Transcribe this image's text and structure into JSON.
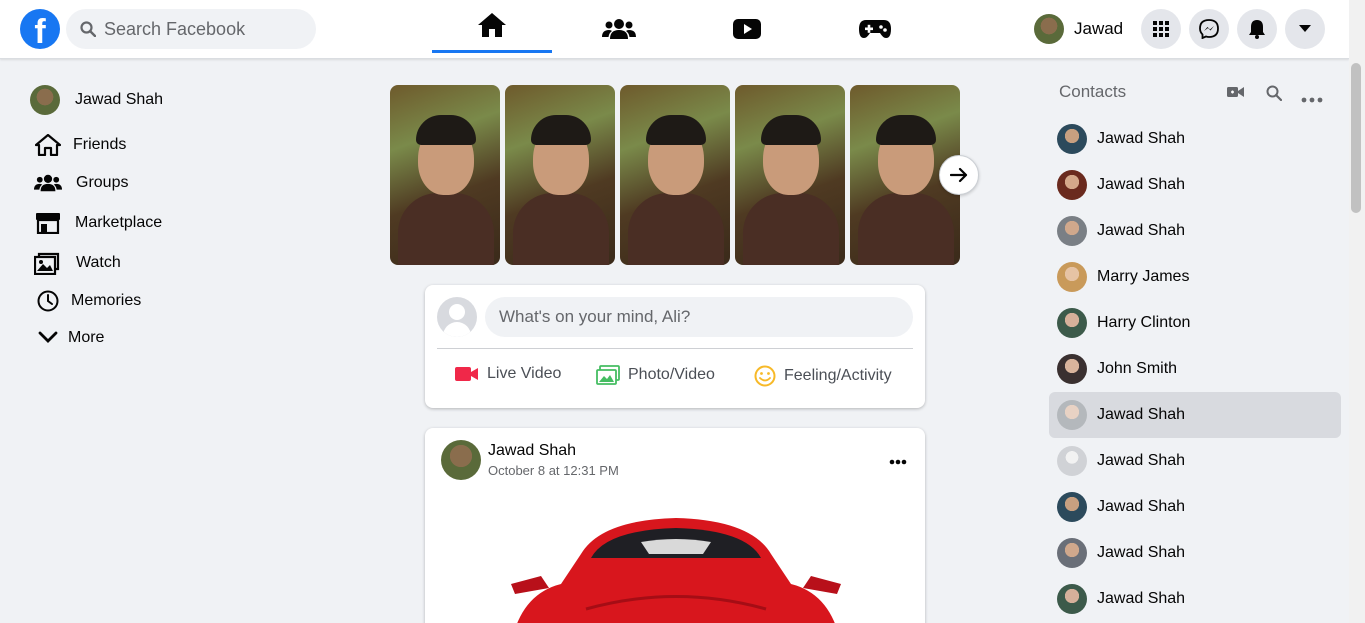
{
  "header": {
    "logo": "f",
    "search_placeholder": "Search Facebook",
    "tabs": [
      "home-icon",
      "friends-icon",
      "watch-icon",
      "gaming-icon"
    ],
    "user_name": "Jawad",
    "accent": "#1877f2"
  },
  "left": {
    "profile_name": "Jawad Shah",
    "items": [
      {
        "label": "Friends",
        "icon": "home-icon"
      },
      {
        "label": "Groups",
        "icon": "groups-icon"
      },
      {
        "label": "Marketplace",
        "icon": "marketplace-icon"
      },
      {
        "label": "Watch",
        "icon": "watch-icon"
      },
      {
        "label": "Memories",
        "icon": "clock-icon"
      },
      {
        "label": "More",
        "icon": "chevron-down-icon"
      }
    ]
  },
  "composer": {
    "placeholder": "What's on your mind, Ali?",
    "live": "Live Video",
    "photo": "Photo/Video",
    "feeling": "Feeling/Activity"
  },
  "post": {
    "author": "Jawad Shah",
    "date": "October 8 at 12:31 PM"
  },
  "contacts": {
    "title": "Contacts",
    "items": [
      {
        "name": "Jawad Shah"
      },
      {
        "name": "Jawad Shah"
      },
      {
        "name": "Jawad Shah"
      },
      {
        "name": "Marry James"
      },
      {
        "name": "Harry Clinton"
      },
      {
        "name": "John Smith"
      },
      {
        "name": "Jawad Shah",
        "highlighted": true
      },
      {
        "name": "Jawad Shah"
      },
      {
        "name": "Jawad Shah"
      },
      {
        "name": "Jawad Shah"
      },
      {
        "name": "Jawad Shah"
      }
    ]
  }
}
